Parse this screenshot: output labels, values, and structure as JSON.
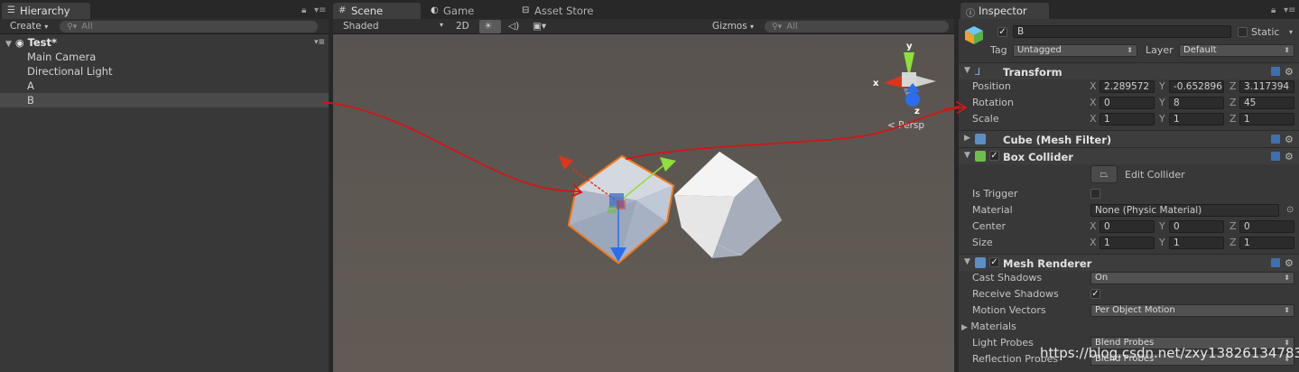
{
  "hierarchy": {
    "tab": "Hierarchy",
    "create_label": "Create",
    "search_placeholder": "All",
    "scene_name": "Test*",
    "items": [
      {
        "label": "Main Camera"
      },
      {
        "label": "Directional Light"
      },
      {
        "label": "A"
      },
      {
        "label": "B",
        "selected": true
      }
    ]
  },
  "scene_view": {
    "tabs": [
      "Scene",
      "Game",
      "Asset Store"
    ],
    "shading_mode": "Shaded",
    "mode_2d": "2D",
    "gizmos_label": "Gizmos",
    "search_placeholder": "All",
    "gizmo_axis_y": "y",
    "gizmo_axis_x": "x",
    "gizmo_axis_z": "z",
    "projection_label": "Persp"
  },
  "inspector": {
    "tab": "Inspector",
    "object_name": "B",
    "object_active": true,
    "static_label": "Static",
    "tag_label": "Tag",
    "tag_value": "Untagged",
    "layer_label": "Layer",
    "layer_value": "Default",
    "transform": {
      "title": "Transform",
      "position_label": "Position",
      "rotation_label": "Rotation",
      "scale_label": "Scale",
      "axis_x": "X",
      "axis_y": "Y",
      "axis_z": "Z",
      "position": [
        "2.289572",
        "-0.652896",
        "3.117394"
      ],
      "rotation": [
        "0",
        "8",
        "45"
      ],
      "scale": [
        "1",
        "1",
        "1"
      ]
    },
    "mesh_filter": {
      "title": "Cube (Mesh Filter)"
    },
    "box_collider": {
      "title": "Box Collider",
      "edit_label": "Edit Collider",
      "is_trigger_label": "Is Trigger",
      "material_label": "Material",
      "material_value": "None (Physic Material)",
      "center_label": "Center",
      "size_label": "Size",
      "center": [
        "0",
        "0",
        "0"
      ],
      "size": [
        "1",
        "1",
        "1"
      ]
    },
    "mesh_renderer": {
      "title": "Mesh Renderer",
      "cast_shadows_label": "Cast Shadows",
      "cast_shadows_value": "On",
      "receive_shadows_label": "Receive Shadows",
      "motion_vectors_label": "Motion Vectors",
      "motion_vectors_value": "Per Object Motion",
      "materials_label": "Materials",
      "light_probes_label": "Light Probes",
      "light_probes_value": "Blend Probes",
      "reflection_probes_label": "Reflection Probes",
      "reflection_probes_value": "Blend Probes"
    }
  },
  "watermark": "https://blog.csdn.net/zxy13826134783",
  "colors": {
    "selection_outline": "#f07a1a",
    "annotation_arrow": "#d01616",
    "axis_x": "#e0331c",
    "axis_y": "#8ee03a",
    "axis_z": "#2c6df0"
  }
}
